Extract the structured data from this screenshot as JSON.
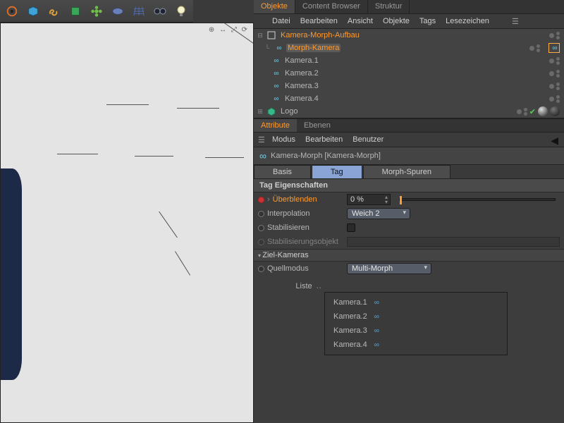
{
  "toolbar_icons": [
    "gear",
    "cube",
    "link",
    "cube-plus",
    "flower",
    "disc",
    "grid",
    "glasses",
    "bulb"
  ],
  "viewport": {
    "gizmo": "⊕ ↔ ⤢ ⟳"
  },
  "objects_panel": {
    "tabs": [
      "Objekte",
      "Content Browser",
      "Struktur"
    ],
    "active_tab": 0,
    "menu": [
      "Datei",
      "Bearbeiten",
      "Ansicht",
      "Objekte",
      "Tags",
      "Lesezeichen"
    ],
    "tree": [
      {
        "indent": 0,
        "expander": "⊟",
        "icon": "null",
        "label": "Kamera-Morph-Aufbau",
        "sel": "sel",
        "tag": false
      },
      {
        "indent": 1,
        "expander": "└",
        "icon": "cam",
        "label": "Morph-Kamera",
        "sel": "selhl",
        "tag": true
      },
      {
        "indent": 1,
        "expander": "",
        "icon": "cam",
        "label": "Kamera.1"
      },
      {
        "indent": 1,
        "expander": "",
        "icon": "cam",
        "label": "Kamera.2"
      },
      {
        "indent": 1,
        "expander": "",
        "icon": "cam",
        "label": "Kamera.3"
      },
      {
        "indent": 1,
        "expander": "",
        "icon": "cam",
        "label": "Kamera.4"
      },
      {
        "indent": 0,
        "expander": "⊞",
        "icon": "poly",
        "label": "Logo",
        "extras": true
      }
    ]
  },
  "attr_panel": {
    "tabs": [
      "Attribute",
      "Ebenen"
    ],
    "active_tab": 0,
    "menu": [
      "Modus",
      "Bearbeiten",
      "Benutzer"
    ],
    "object_title": "Kamera-Morph [Kamera-Morph]",
    "subtabs": [
      "Basis",
      "Tag",
      "Morph-Spuren"
    ],
    "active_subtab": 1,
    "section": "Tag Eigenschaften",
    "props": {
      "blend_label": "Überblenden",
      "blend_value": "0 %",
      "interp_label": "Interpolation",
      "interp_value": "Weich 2",
      "stab_label": "Stabilisieren",
      "stabobj_label": "Stabilisierungsobjekt",
      "target_header": "Ziel-Kameras",
      "src_label": "Quellmodus",
      "src_value": "Multi-Morph",
      "list_label": "Liste",
      "list": [
        "Kamera.1",
        "Kamera.2",
        "Kamera.3",
        "Kamera.4"
      ]
    }
  }
}
